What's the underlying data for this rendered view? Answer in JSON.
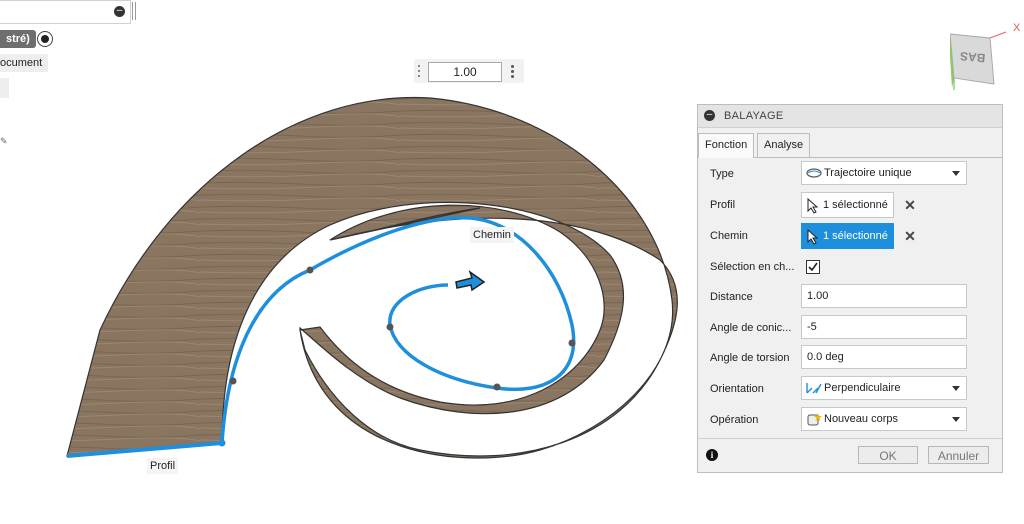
{
  "left_panel": {
    "mode_label": "stré)",
    "doc_label": "ocument"
  },
  "value_box": {
    "value": "1.00"
  },
  "viewcube": {
    "face_label": "BAS",
    "axis_label": "X"
  },
  "canvas": {
    "profile_label": "Profil",
    "path_label": "Chemin",
    "colors": {
      "wood": "#8a7560",
      "path": "#1e8fdd"
    }
  },
  "dialog": {
    "title": "BALAYAGE",
    "tabs": [
      "Fonction",
      "Analyse"
    ],
    "rows": {
      "type_label": "Type",
      "type_value": "Trajectoire unique",
      "profil_label": "Profil",
      "profil_value": "1 sélectionné",
      "chemin_label": "Chemin",
      "chemin_value": "1 sélectionné",
      "selection_label": "Sélection en ch...",
      "distance_label": "Distance",
      "distance_value": "1.00",
      "conic_label": "Angle de conic...",
      "conic_value": "-5",
      "torsion_label": "Angle de torsion",
      "torsion_value": "0.0 deg",
      "orientation_label": "Orientation",
      "orientation_value": "Perpendiculaire",
      "operation_label": "Opération",
      "operation_value": "Nouveau corps"
    },
    "ok_label": "OK",
    "cancel_label": "Annuler",
    "accent": "#1e8fdd"
  }
}
